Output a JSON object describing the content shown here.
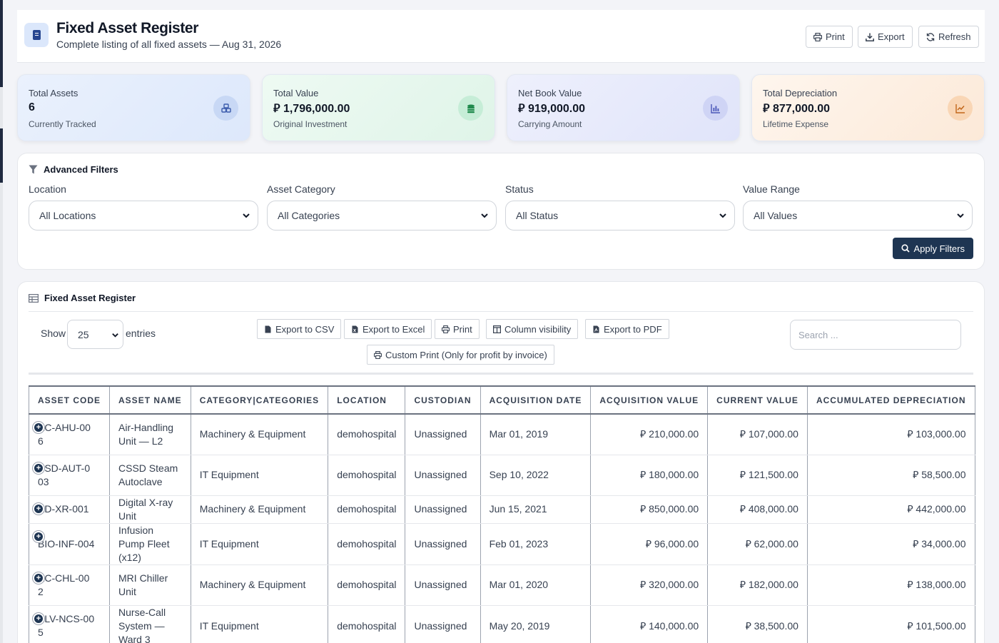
{
  "header": {
    "title": "Fixed Asset Register",
    "subtitle": "Complete listing of all fixed assets — Aug 31, 2026",
    "buttons": {
      "print": "Print",
      "export": "Export",
      "refresh": "Refresh"
    }
  },
  "stats": [
    {
      "label": "Total Assets",
      "value": "6",
      "sub": "Currently Tracked",
      "icon": "cubes-icon"
    },
    {
      "label": "Total Value",
      "value": "⃁ 1,796,000.00",
      "sub": "Original Investment",
      "icon": "coins-icon"
    },
    {
      "label": "Net Book Value",
      "value": "⃁ 919,000.00",
      "sub": "Carrying Amount",
      "icon": "chart-bar-icon"
    },
    {
      "label": "Total Depreciation",
      "value": "⃁ 877,000.00",
      "sub": "Lifetime Expense",
      "icon": "chart-line-icon"
    }
  ],
  "filters": {
    "title": "Advanced Filters",
    "location": {
      "label": "Location",
      "value": "All Locations"
    },
    "category": {
      "label": "Asset Category",
      "value": "All Categories"
    },
    "status": {
      "label": "Status",
      "value": "All Status"
    },
    "value_range": {
      "label": "Value Range",
      "value": "All Values"
    },
    "apply": "Apply Filters"
  },
  "register": {
    "title": "Fixed Asset Register",
    "show": "Show",
    "entries_value": "25",
    "entries": "entries",
    "search_placeholder": "Search ...",
    "buttons": {
      "csv": "Export to CSV",
      "excel": "Export to Excel",
      "print": "Print",
      "colvis": "Column visibility",
      "pdf": "Export to PDF",
      "custom": "Custom Print (Only for profit by invoice)"
    },
    "columns": [
      "ASSET CODE",
      "ASSET NAME",
      "CATEGORY|CATEGORIES",
      "LOCATION",
      "CUSTODIAN",
      "ACQUISITION DATE",
      "ACQUISITION VALUE",
      "CURRENT VALUE",
      "ACCUMULATED DEPRECIATION"
    ],
    "rows": [
      [
        "AC-AHU-006",
        "Air-Handling Unit — L2",
        "Machinery & Equipment",
        "demohospital",
        "Unassigned",
        "Mar 01, 2019",
        "⃁ 210,000.00",
        "⃁ 107,000.00",
        "⃁ 103,000.00"
      ],
      [
        "SSD-AUT-003",
        "CSSD Steam Autoclave",
        "IT Equipment",
        "demohospital",
        "Unassigned",
        "Sep 10, 2022",
        "⃁ 180,000.00",
        "⃁ 121,500.00",
        "⃁ 58,500.00"
      ],
      [
        "AD-XR-001",
        "Digital X-ray Unit",
        "Machinery & Equipment",
        "demohospital",
        "Unassigned",
        "Jun 15, 2021",
        "⃁ 850,000.00",
        "⃁ 408,000.00",
        "⃁ 442,000.00"
      ],
      [
        "BIO-INF-004",
        "Infusion Pump Fleet (x12)",
        "IT Equipment",
        "demohospital",
        "Unassigned",
        "Feb 01, 2023",
        "⃁ 96,000.00",
        "⃁ 62,000.00",
        "⃁ 34,000.00"
      ],
      [
        "AC-CHL-002",
        "MRI Chiller Unit",
        "Machinery & Equipment",
        "demohospital",
        "Unassigned",
        "Mar 01, 2020",
        "⃁ 320,000.00",
        "⃁ 182,000.00",
        "⃁ 138,000.00"
      ],
      [
        "ELV-NCS-005",
        "Nurse-Call System — Ward 3",
        "IT Equipment",
        "demohospital",
        "Unassigned",
        "May 20, 2019",
        "⃁ 140,000.00",
        "⃁ 38,500.00",
        "⃁ 101,500.00"
      ]
    ]
  },
  "colors": {
    "primary": "#1e3552",
    "blue_card": "#e3ecfb",
    "green_card": "#e6f7ee",
    "purple_card": "#e7e9fb",
    "orange_card": "#fdeee0"
  }
}
